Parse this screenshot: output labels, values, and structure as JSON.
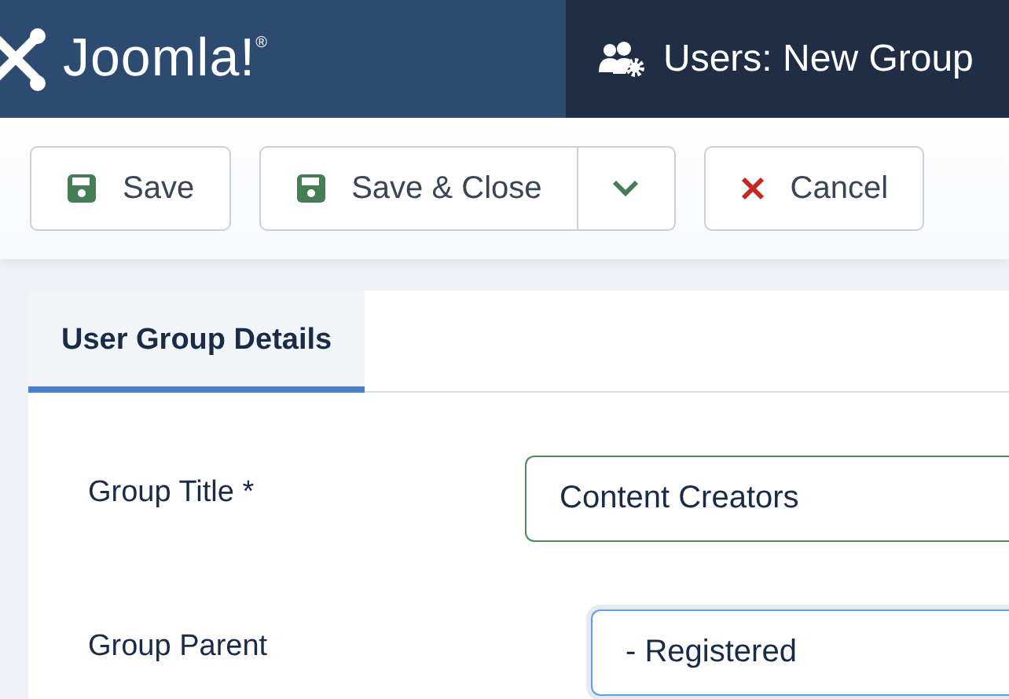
{
  "header": {
    "brand": "Joomla!$^{®}$",
    "title": "Users: New Group"
  },
  "toolbar": {
    "buttons": [
      {
        "label": "Save",
        "kind": "save"
      },
      {
        "label": "Save & Close",
        "kind": "save-split"
      },
      {
        "label": "Cancel",
        "kind": "cancel"
      }
    ]
  },
  "tabs": [
    {
      "label": "User Group Details",
      "selected": true
    }
  ],
  "fields": [
    {
      "label": "Group Title *",
      "value": "Content Creators",
      "kind": "text",
      "valid": true,
      "focused": false
    },
    {
      "label": "Group Parent",
      "value": "- Registered",
      "kind": "select",
      "valid": false,
      "focused": true
    }
  ]
}
